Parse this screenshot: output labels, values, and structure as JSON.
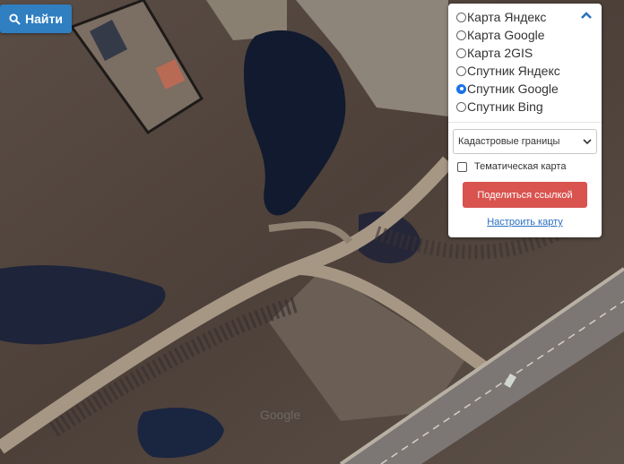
{
  "search": {
    "label": "Найти",
    "icon": "search-icon"
  },
  "layer_panel": {
    "collapse_icon": "chevron-up-icon",
    "layers": [
      {
        "label": "Карта Яндекс",
        "selected": false
      },
      {
        "label": "Карта Google",
        "selected": false
      },
      {
        "label": "Карта 2GIS",
        "selected": false
      },
      {
        "label": "Спутник Яндекс",
        "selected": false
      },
      {
        "label": "Спутник Google",
        "selected": true
      },
      {
        "label": "Спутник Bing",
        "selected": false
      }
    ],
    "overlay_select": {
      "value": "Кадастровые границы"
    },
    "thematic_map": {
      "label": "Тематическая карта",
      "checked": false
    },
    "share_button": "Поделиться ссылкой",
    "settings_link": "Настроить карту"
  },
  "colors": {
    "accent": "#2f7fc1",
    "share": "#d9534f",
    "link": "#2a6fbf",
    "radio_selected": "#1a73e8"
  },
  "map": {
    "watermark": "Google"
  }
}
